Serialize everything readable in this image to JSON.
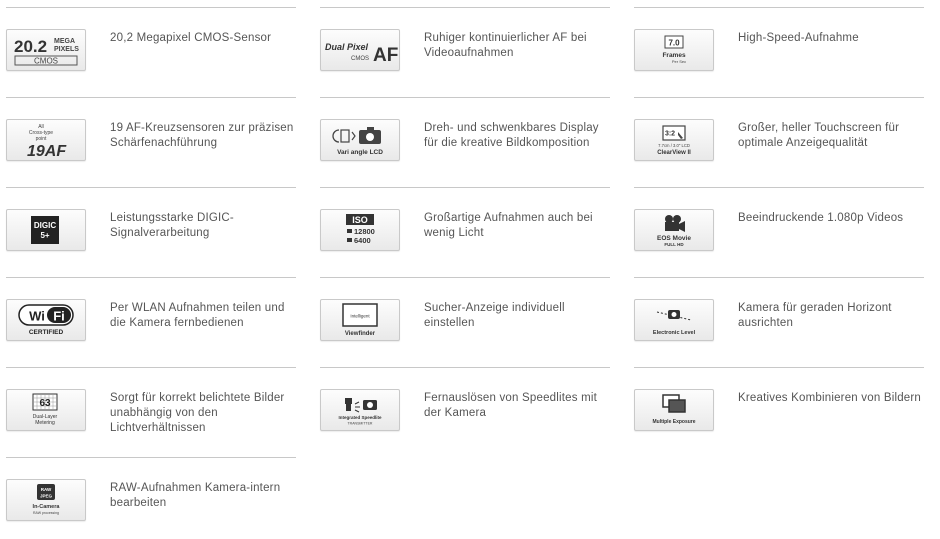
{
  "features": [
    {
      "text": "20,2 Megapixel CMOS-Sensor",
      "icon": "megapixel-cmos-icon",
      "label_a": "20.2",
      "label_b": "MEGA",
      "label_c": "PIXELS",
      "label_d": "CMOS"
    },
    {
      "text": "Ruhiger kontinuierlicher AF bei Videoaufnahmen",
      "icon": "dual-pixel-af-icon",
      "label_a": "Dual Pixel",
      "label_b": "CMOS",
      "label_c": "AF"
    },
    {
      "text": "High-Speed-Aufnahme",
      "icon": "frames-per-sec-icon",
      "label_a": "7.0",
      "label_b": "Frames",
      "label_c": "Per Sec"
    },
    {
      "text": "19 AF-Kreuzsensoren zur präzisen Schärfenachführung",
      "icon": "af-points-icon",
      "label_a": "All",
      "label_b": "Cross-type",
      "label_c": "point",
      "label_d": "19AF"
    },
    {
      "text": "Dreh- und schwenkbares Display für die kreative Bildkomposition",
      "icon": "vari-angle-lcd-icon",
      "label_a": "Vari angle LCD"
    },
    {
      "text": "Großer, heller Touchscreen für optimale Anzeigequalität",
      "icon": "clearview-touchscreen-icon",
      "label_a": "3:2",
      "label_b": "7.7cm / 3.0\" LCD",
      "label_c": "ClearView II"
    },
    {
      "text": "Leistungsstarke DIGIC-Signalverarbeitung",
      "icon": "digic-processor-icon",
      "label_a": "DIGIC",
      "label_b": "5+"
    },
    {
      "text": "Großartige Aufnahmen auch bei wenig Licht",
      "icon": "iso-range-icon",
      "label_a": "ISO",
      "label_b": "12800",
      "label_c": "6400"
    },
    {
      "text": "Beeindruckende 1.080p Videos",
      "icon": "eos-movie-icon",
      "label_a": "EOS Movie",
      "label_b": "FULL HD"
    },
    {
      "text": "Per WLAN Aufnahmen teilen und die Kamera fernbedienen",
      "icon": "wifi-certified-icon",
      "label_a": "Wi",
      "label_b": "Fi",
      "label_c": "CERTIFIED"
    },
    {
      "text": "Sucher-Anzeige individuell einstellen",
      "icon": "intelligent-viewfinder-icon",
      "label_a": "Intelligent",
      "label_b": "Viewfinder"
    },
    {
      "text": "Kamera für geraden Horizont ausrichten",
      "icon": "electronic-level-icon",
      "label_a": "Electronic Level"
    },
    {
      "text": "Sorgt für korrekt belichtete Bilder unabhängig von den Lichtverhältnissen",
      "icon": "dual-layer-metering-icon",
      "label_a": "63",
      "label_b": "Dual-Layer",
      "label_c": "Metering"
    },
    {
      "text": "Fernauslösen von Speedlites mit der Kamera",
      "icon": "integrated-speedlite-icon",
      "label_a": "Integrated Speedlite",
      "label_b": "TRANSMITTER"
    },
    {
      "text": "Kreatives Kombinieren von Bildern",
      "icon": "multiple-exposure-icon",
      "label_a": "Multiple Exposure"
    },
    {
      "text": "RAW-Aufnahmen Kamera-intern bearbeiten",
      "icon": "in-camera-raw-icon",
      "label_a": "RAW",
      "label_b": "JPEG",
      "label_c": "In-Camera",
      "label_d": "RAW processing"
    }
  ]
}
